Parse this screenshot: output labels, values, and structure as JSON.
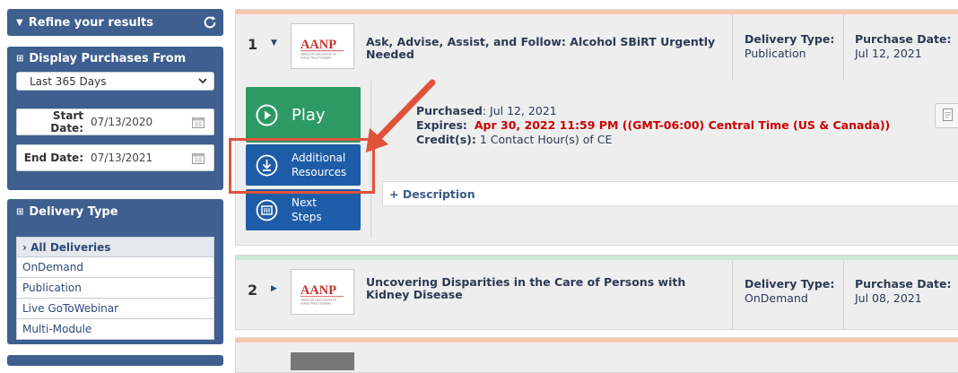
{
  "sidebar": {
    "refine": {
      "title": "Refine your results"
    },
    "purchases": {
      "title": "Display Purchases From",
      "range_selected": "Last 365 Days",
      "start_label": "Start Date:",
      "start_value": "07/13/2020",
      "end_label": "End Date:",
      "end_value": "07/13/2021"
    },
    "delivery": {
      "title": "Delivery Type",
      "items": [
        {
          "label": "All Deliveries"
        },
        {
          "label": "OnDemand"
        },
        {
          "label": "Publication"
        },
        {
          "label": "Live GoToWebinar"
        },
        {
          "label": "Multi-Module"
        }
      ]
    }
  },
  "results": [
    {
      "number": "1",
      "title": "Ask, Advise, Assist, and Follow: Alcohol SBiRT Urgently Needed",
      "delivery_label": "Delivery Type:",
      "delivery_value": "Publication",
      "purchase_label": "Purchase Date:",
      "purchase_value": "Jul 12, 2021",
      "purchased_label": "Purchased",
      "purchased_value": ": Jul 12, 2021",
      "expires_label": "Expires:",
      "expires_value": "Apr 30, 2022 11:59 PM ((GMT-06:00) Central Time (US & Canada))",
      "credits_label": "Credit(s):",
      "credits_value": "1 Contact Hour(s) of CE",
      "description_label": "+ Description",
      "buttons": {
        "play": "Play",
        "additional": [
          "Additional",
          "Resources"
        ],
        "next": [
          "Next",
          "Steps"
        ]
      }
    },
    {
      "number": "2",
      "title": "Uncovering Disparities in the Care of Persons with Kidney Disease",
      "delivery_label": "Delivery Type:",
      "delivery_value": "OnDemand",
      "purchase_label": "Purchase Date:",
      "purchase_value": "Jul 08, 2021"
    }
  ],
  "logo": {
    "text": "AANP",
    "subtext": "AMERICAN ASSOCIATION OF NURSE PRACTITIONERS"
  },
  "colors": {
    "sidebar": "#3e5f8f",
    "play": "#2e9a63",
    "action": "#1d5da8",
    "highlight": "#e0523a",
    "expires": "#cc0000"
  }
}
